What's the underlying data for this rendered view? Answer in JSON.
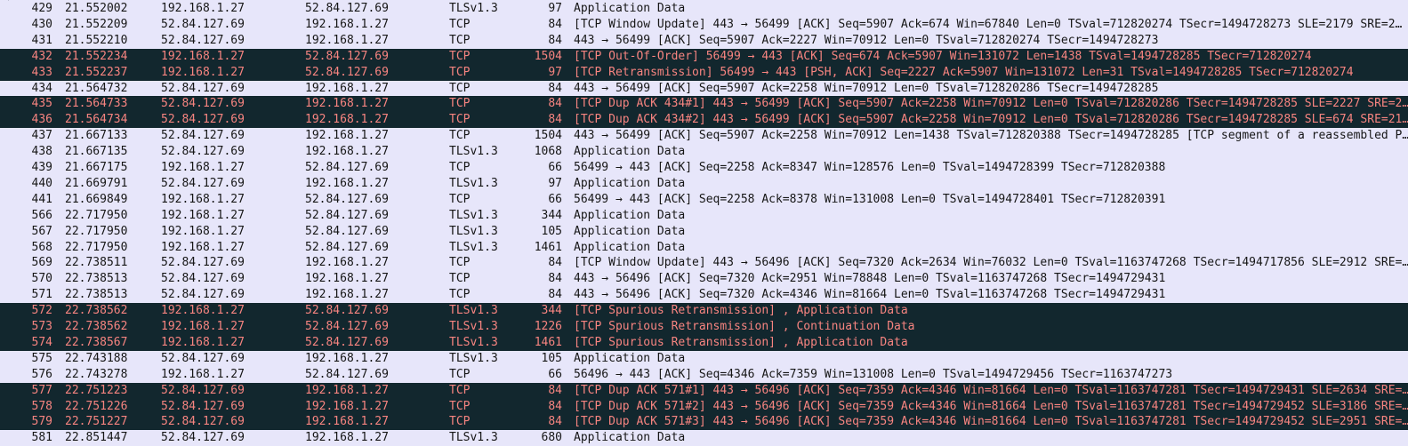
{
  "colors": {
    "normal_bg": "#e7e6fa",
    "normal_fg": "#161616",
    "alert_bg": "#12272e",
    "alert_fg": "#f78480"
  },
  "packets": [
    {
      "no": "429",
      "time": "21.552002",
      "src": "192.168.1.27",
      "dst": "52.84.127.69",
      "proto": "TLSv1.3",
      "len": "97",
      "info": "Application Data",
      "alert": false
    },
    {
      "no": "430",
      "time": "21.552209",
      "src": "52.84.127.69",
      "dst": "192.168.1.27",
      "proto": "TCP",
      "len": "84",
      "info": "[TCP Window Update] 443 → 56499 [ACK] Seq=5907 Ack=674 Win=67840 Len=0 TSval=712820274 TSecr=1494728273 SLE=2179 SRE=2…",
      "alert": false
    },
    {
      "no": "431",
      "time": "21.552210",
      "src": "52.84.127.69",
      "dst": "192.168.1.27",
      "proto": "TCP",
      "len": "84",
      "info": "443 → 56499 [ACK] Seq=5907 Ack=2227 Win=70912 Len=0 TSval=712820274 TSecr=1494728273",
      "alert": false
    },
    {
      "no": "432",
      "time": "21.552234",
      "src": "192.168.1.27",
      "dst": "52.84.127.69",
      "proto": "TCP",
      "len": "1504",
      "info": "[TCP Out-Of-Order] 56499 → 443 [ACK] Seq=674 Ack=5907 Win=131072 Len=1438 TSval=1494728285 TSecr=712820274",
      "alert": true
    },
    {
      "no": "433",
      "time": "21.552237",
      "src": "192.168.1.27",
      "dst": "52.84.127.69",
      "proto": "TCP",
      "len": "97",
      "info": "[TCP Retransmission] 56499 → 443 [PSH, ACK] Seq=2227 Ack=5907 Win=131072 Len=31 TSval=1494728285 TSecr=712820274",
      "alert": true
    },
    {
      "no": "434",
      "time": "21.564732",
      "src": "52.84.127.69",
      "dst": "192.168.1.27",
      "proto": "TCP",
      "len": "84",
      "info": "443 → 56499 [ACK] Seq=5907 Ack=2258 Win=70912 Len=0 TSval=712820286 TSecr=1494728285",
      "alert": false
    },
    {
      "no": "435",
      "time": "21.564733",
      "src": "52.84.127.69",
      "dst": "192.168.1.27",
      "proto": "TCP",
      "len": "84",
      "info": "[TCP Dup ACK 434#1] 443 → 56499 [ACK] Seq=5907 Ack=2258 Win=70912 Len=0 TSval=712820286 TSecr=1494728285 SLE=2227 SRE=2…",
      "alert": true
    },
    {
      "no": "436",
      "time": "21.564734",
      "src": "52.84.127.69",
      "dst": "192.168.1.27",
      "proto": "TCP",
      "len": "84",
      "info": "[TCP Dup ACK 434#2] 443 → 56499 [ACK] Seq=5907 Ack=2258 Win=70912 Len=0 TSval=712820286 TSecr=1494728285 SLE=674 SRE=21…",
      "alert": true
    },
    {
      "no": "437",
      "time": "21.667133",
      "src": "52.84.127.69",
      "dst": "192.168.1.27",
      "proto": "TCP",
      "len": "1504",
      "info": "443 → 56499 [ACK] Seq=5907 Ack=2258 Win=70912 Len=1438 TSval=712820388 TSecr=1494728285 [TCP segment of a reassembled P…",
      "alert": false
    },
    {
      "no": "438",
      "time": "21.667135",
      "src": "52.84.127.69",
      "dst": "192.168.1.27",
      "proto": "TLSv1.3",
      "len": "1068",
      "info": "Application Data",
      "alert": false
    },
    {
      "no": "439",
      "time": "21.667175",
      "src": "192.168.1.27",
      "dst": "52.84.127.69",
      "proto": "TCP",
      "len": "66",
      "info": "56499 → 443 [ACK] Seq=2258 Ack=8347 Win=128576 Len=0 TSval=1494728399 TSecr=712820388",
      "alert": false
    },
    {
      "no": "440",
      "time": "21.669791",
      "src": "52.84.127.69",
      "dst": "192.168.1.27",
      "proto": "TLSv1.3",
      "len": "97",
      "info": "Application Data",
      "alert": false
    },
    {
      "no": "441",
      "time": "21.669849",
      "src": "192.168.1.27",
      "dst": "52.84.127.69",
      "proto": "TCP",
      "len": "66",
      "info": "56499 → 443 [ACK] Seq=2258 Ack=8378 Win=131008 Len=0 TSval=1494728401 TSecr=712820391",
      "alert": false
    },
    {
      "no": "566",
      "time": "22.717950",
      "src": "192.168.1.27",
      "dst": "52.84.127.69",
      "proto": "TLSv1.3",
      "len": "344",
      "info": "Application Data",
      "alert": false
    },
    {
      "no": "567",
      "time": "22.717950",
      "src": "192.168.1.27",
      "dst": "52.84.127.69",
      "proto": "TLSv1.3",
      "len": "105",
      "info": "Application Data",
      "alert": false
    },
    {
      "no": "568",
      "time": "22.717950",
      "src": "192.168.1.27",
      "dst": "52.84.127.69",
      "proto": "TLSv1.3",
      "len": "1461",
      "info": "Application Data",
      "alert": false
    },
    {
      "no": "569",
      "time": "22.738511",
      "src": "52.84.127.69",
      "dst": "192.168.1.27",
      "proto": "TCP",
      "len": "84",
      "info": "[TCP Window Update] 443 → 56496 [ACK] Seq=7320 Ack=2634 Win=76032 Len=0 TSval=1163747268 TSecr=1494717856 SLE=2912 SRE=…",
      "alert": false
    },
    {
      "no": "570",
      "time": "22.738513",
      "src": "52.84.127.69",
      "dst": "192.168.1.27",
      "proto": "TCP",
      "len": "84",
      "info": "443 → 56496 [ACK] Seq=7320 Ack=2951 Win=78848 Len=0 TSval=1163747268 TSecr=1494729431",
      "alert": false
    },
    {
      "no": "571",
      "time": "22.738513",
      "src": "52.84.127.69",
      "dst": "192.168.1.27",
      "proto": "TCP",
      "len": "84",
      "info": "443 → 56496 [ACK] Seq=7320 Ack=4346 Win=81664 Len=0 TSval=1163747268 TSecr=1494729431",
      "alert": false
    },
    {
      "no": "572",
      "time": "22.738562",
      "src": "192.168.1.27",
      "dst": "52.84.127.69",
      "proto": "TLSv1.3",
      "len": "344",
      "info": "[TCP Spurious Retransmission] , Application Data",
      "alert": true
    },
    {
      "no": "573",
      "time": "22.738562",
      "src": "192.168.1.27",
      "dst": "52.84.127.69",
      "proto": "TLSv1.3",
      "len": "1226",
      "info": "[TCP Spurious Retransmission] , Continuation Data",
      "alert": true
    },
    {
      "no": "574",
      "time": "22.738567",
      "src": "192.168.1.27",
      "dst": "52.84.127.69",
      "proto": "TLSv1.3",
      "len": "1461",
      "info": "[TCP Spurious Retransmission] , Application Data",
      "alert": true
    },
    {
      "no": "575",
      "time": "22.743188",
      "src": "52.84.127.69",
      "dst": "192.168.1.27",
      "proto": "TLSv1.3",
      "len": "105",
      "info": "Application Data",
      "alert": false
    },
    {
      "no": "576",
      "time": "22.743278",
      "src": "192.168.1.27",
      "dst": "52.84.127.69",
      "proto": "TCP",
      "len": "66",
      "info": "56496 → 443 [ACK] Seq=4346 Ack=7359 Win=131008 Len=0 TSval=1494729456 TSecr=1163747273",
      "alert": false
    },
    {
      "no": "577",
      "time": "22.751223",
      "src": "52.84.127.69",
      "dst": "192.168.1.27",
      "proto": "TCP",
      "len": "84",
      "info": "[TCP Dup ACK 571#1] 443 → 56496 [ACK] Seq=7359 Ack=4346 Win=81664 Len=0 TSval=1163747281 TSecr=1494729431 SLE=2634 SRE=…",
      "alert": true
    },
    {
      "no": "578",
      "time": "22.751226",
      "src": "52.84.127.69",
      "dst": "192.168.1.27",
      "proto": "TCP",
      "len": "84",
      "info": "[TCP Dup ACK 571#2] 443 → 56496 [ACK] Seq=7359 Ack=4346 Win=81664 Len=0 TSval=1163747281 TSecr=1494729452 SLE=3186 SRE=…",
      "alert": true
    },
    {
      "no": "579",
      "time": "22.751227",
      "src": "52.84.127.69",
      "dst": "192.168.1.27",
      "proto": "TCP",
      "len": "84",
      "info": "[TCP Dup ACK 571#3] 443 → 56496 [ACK] Seq=7359 Ack=4346 Win=81664 Len=0 TSval=1163747281 TSecr=1494729452 SLE=2951 SRE=…",
      "alert": true
    },
    {
      "no": "581",
      "time": "22.851447",
      "src": "52.84.127.69",
      "dst": "192.168.1.27",
      "proto": "TLSv1.3",
      "len": "680",
      "info": "Application Data",
      "alert": false
    }
  ]
}
